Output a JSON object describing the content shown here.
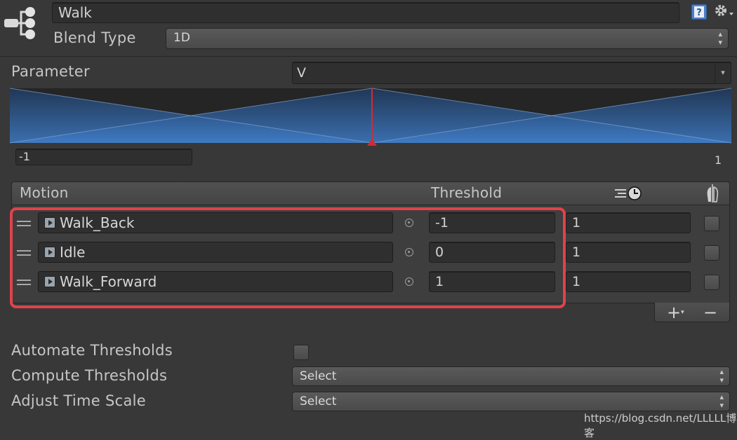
{
  "header": {
    "name": "Walk",
    "blend_type_label": "Blend Type",
    "blend_type_value": "1D"
  },
  "parameter": {
    "label": "Parameter",
    "value": "V"
  },
  "graph": {
    "min_value": "-1",
    "max_label": "1",
    "marker_value": 0
  },
  "motion_table": {
    "headers": {
      "motion": "Motion",
      "threshold": "Threshold"
    },
    "rows": [
      {
        "motion": "Walk_Back",
        "threshold": "-1",
        "time_scale": "1"
      },
      {
        "motion": "Idle",
        "threshold": "0",
        "time_scale": "1"
      },
      {
        "motion": "Walk_Forward",
        "threshold": "1",
        "time_scale": "1"
      }
    ],
    "add_label": "+",
    "remove_label": "−"
  },
  "options": {
    "automate_thresholds_label": "Automate Thresholds",
    "compute_thresholds_label": "Compute Thresholds",
    "compute_thresholds_value": "Select",
    "adjust_time_scale_label": "Adjust Time Scale",
    "adjust_time_scale_value": "Select"
  },
  "watermark": "https://blog.csdn.net/LLLLL博客",
  "colors": {
    "highlight_border": "#e0434a",
    "graph_blue": "#3a6fb0",
    "marker_red": "#d8292f"
  },
  "icons": [
    "blend-tree-icon",
    "help-icon",
    "gear-icon",
    "clock-icon",
    "mirror-icon"
  ]
}
